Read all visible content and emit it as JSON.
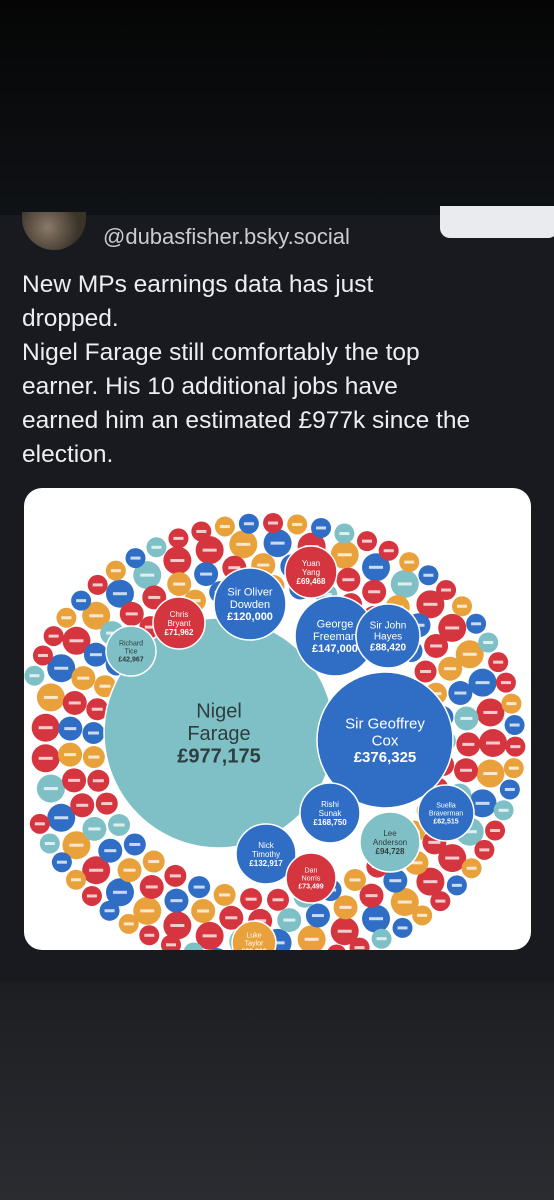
{
  "post": {
    "handle": "@dubasfisher.bsky.social",
    "text_lines": [
      "New MPs earnings data has just",
      "dropped.",
      "Nigel Farage still comfortably the top",
      "earner. His 10 additional jobs have",
      "earned him an estimated £977k since the",
      "election."
    ]
  },
  "colors": {
    "teal": "#7fc0c6",
    "blue": "#2f6ec4",
    "red": "#d5353f",
    "orange": "#e9a23b"
  },
  "chart_data": {
    "type": "bubble",
    "bubbles": [
      {
        "name": "Nigel Farage",
        "value": "£977,175",
        "color": "teal"
      },
      {
        "name": "Sir Geoffrey Cox",
        "value": "£376,325",
        "color": "blue"
      },
      {
        "name": "George Freeman",
        "value": "£147,000",
        "color": "blue"
      },
      {
        "name": "Sir Oliver Dowden",
        "value": "£120,000",
        "color": "blue"
      },
      {
        "name": "Sir John Hayes",
        "value": "£88,420",
        "color": "blue"
      },
      {
        "name": "Yuan Yang",
        "value": "£69,468",
        "color": "red"
      },
      {
        "name": "Chris Bryant",
        "value": "£71,962",
        "color": "red"
      },
      {
        "name": "Richard Tice",
        "value": "£42,967",
        "color": "teal"
      },
      {
        "name": "Rishi Sunak",
        "value": "£168,750",
        "color": "blue"
      },
      {
        "name": "Lee Anderson",
        "value": "£94,728",
        "color": "teal"
      },
      {
        "name": "Suella Braverman",
        "value": "£62,515",
        "color": "blue"
      },
      {
        "name": "Nick Timothy",
        "value": "£132,917",
        "color": "blue"
      },
      {
        "name": "Dan Norris",
        "value": "£73,499",
        "color": "red"
      },
      {
        "name": "Luke Taylor",
        "value": "£28,992",
        "color": "orange"
      }
    ]
  }
}
